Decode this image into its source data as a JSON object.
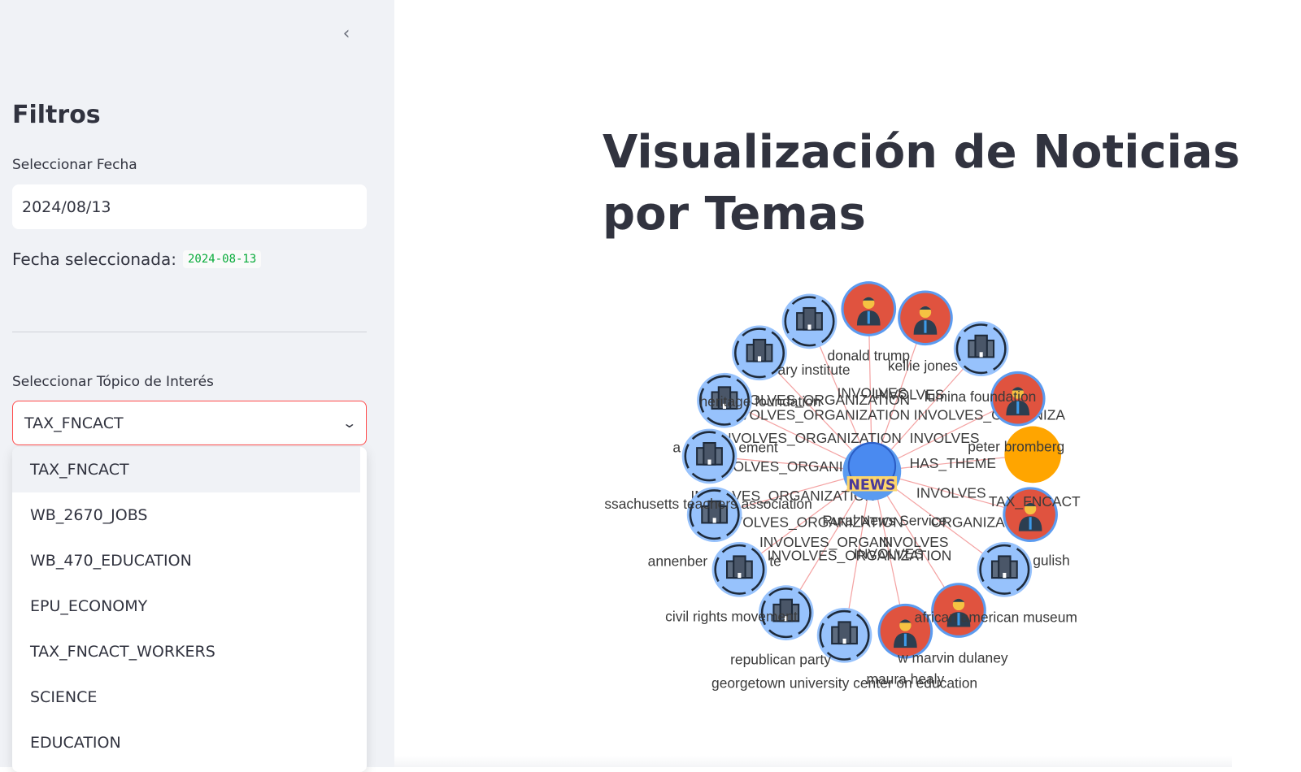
{
  "sidebar": {
    "collapse_icon": "chevron-left-icon",
    "heading": "Filtros",
    "date_label": "Seleccionar Fecha",
    "date_value": "2024/08/13",
    "selected_label": "Fecha seleccionada:",
    "selected_value": "2024-08-13",
    "topic_label": "Seleccionar Tópico de Interés",
    "topic_value": "TAX_FNCACT",
    "options": [
      "TAX_FNCACT",
      "WB_2670_JOBS",
      "WB_470_EDUCATION",
      "EPU_ECONOMY",
      "TAX_FNCACT_WORKERS",
      "SCIENCE",
      "EDUCATION"
    ]
  },
  "main": {
    "title": "Visualización de Noticias por Temas"
  },
  "graph": {
    "colors": {
      "org": "#97c2fc",
      "person": "#e0533f",
      "theme": "#ffa500",
      "edge": "#f4a3a3"
    },
    "center_label": "NEWS",
    "node_labels": [
      "donald trump",
      "kellie jones",
      "ary institute",
      "heritage foundation",
      "lumina foundation",
      "a",
      "ement",
      "peter bromberg",
      "TAX_FNCACT",
      "ssachusetts teachers association",
      "annenber",
      "te",
      "gulish",
      "civil rights movement",
      "african american museum",
      "republican party",
      "w marvin dulaney",
      "maura healy",
      "georgetown university center on education",
      "Rural News Service"
    ],
    "edge_labels": [
      "INVOLVES_ORGANIZATION",
      "INVOLVES_ORGANIZATION",
      "INVOLVES",
      "INVOLVES",
      "INVOLVES_ORGANIZA",
      "INVOLVES_ORGANIZATION",
      "INVOLVES",
      "INVOLVES_ORGANI",
      "HAS_THEME",
      "INVOLVES_ORGANIZATION",
      "INVOLVES",
      "INVOLVES_ORGANIZATION",
      "ORGANIZA",
      "INVOLVES_ORGANI",
      "INVOLVES",
      "INVOLVES_ORGANIZATION",
      "INVOLVES"
    ]
  }
}
